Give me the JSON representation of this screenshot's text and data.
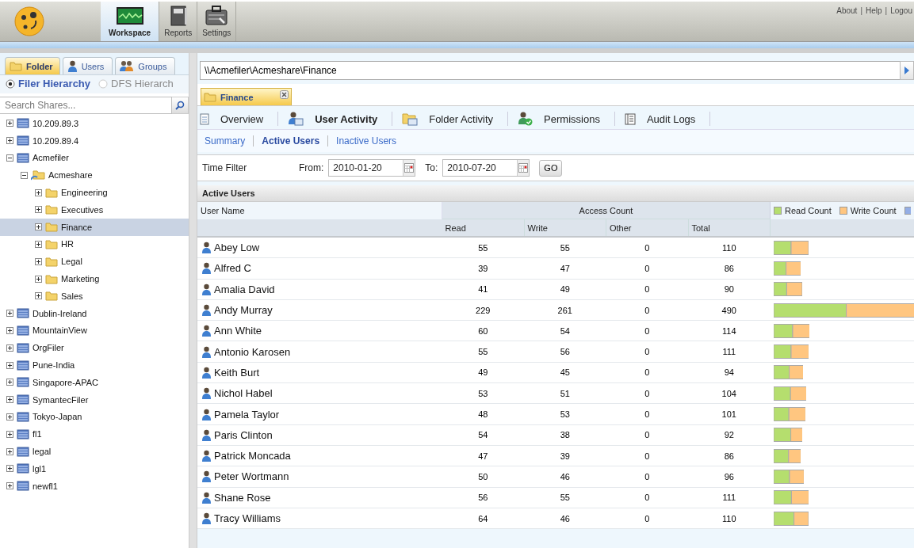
{
  "header": {
    "nav": [
      {
        "label": "Workspace",
        "kind": "monitor",
        "selected": true
      },
      {
        "label": "Reports",
        "kind": "book",
        "selected": false
      },
      {
        "label": "Settings",
        "kind": "toolbox",
        "selected": false
      }
    ],
    "links": [
      "About",
      "Help",
      "Logou"
    ],
    "link_separator": "|"
  },
  "sidebar": {
    "tabs": [
      {
        "label": "Folder",
        "kind": "folder",
        "selected": true
      },
      {
        "label": "Users",
        "kind": "user",
        "selected": false
      },
      {
        "label": "Groups",
        "kind": "group",
        "selected": false
      }
    ],
    "hierarchy": [
      {
        "label": "Filer Hierarchy",
        "selected": true,
        "disabled": false
      },
      {
        "label": "DFS Hierarch",
        "selected": false,
        "disabled": true
      }
    ],
    "search": {
      "placeholder": "Search Shares..."
    },
    "tree": [
      {
        "label": "10.209.89.3",
        "kind": "filer",
        "expanded": false,
        "selected": false
      },
      {
        "label": "10.209.89.4",
        "kind": "filer",
        "expanded": false,
        "selected": false
      },
      {
        "label": "Acmefiler",
        "kind": "filer",
        "expanded": true,
        "selected": false,
        "children": [
          {
            "label": "Acmeshare",
            "kind": "share",
            "expanded": true,
            "selected": false,
            "children": [
              {
                "label": "Engineering",
                "kind": "folder",
                "expanded": false,
                "selected": false
              },
              {
                "label": "Executives",
                "kind": "folder",
                "expanded": false,
                "selected": false
              },
              {
                "label": "Finance",
                "kind": "folder",
                "expanded": false,
                "selected": true
              },
              {
                "label": "HR",
                "kind": "folder",
                "expanded": false,
                "selected": false
              },
              {
                "label": "Legal",
                "kind": "folder",
                "expanded": false,
                "selected": false
              },
              {
                "label": "Marketing",
                "kind": "folder",
                "expanded": false,
                "selected": false
              },
              {
                "label": "Sales",
                "kind": "folder",
                "expanded": false,
                "selected": false
              }
            ]
          }
        ]
      },
      {
        "label": "Dublin-Ireland",
        "kind": "filer",
        "expanded": false,
        "selected": false
      },
      {
        "label": "MountainView",
        "kind": "filer",
        "expanded": false,
        "selected": false
      },
      {
        "label": "OrgFiler",
        "kind": "filer",
        "expanded": false,
        "selected": false
      },
      {
        "label": "Pune-India",
        "kind": "filer",
        "expanded": false,
        "selected": false
      },
      {
        "label": "Singapore-APAC",
        "kind": "filer",
        "expanded": false,
        "selected": false
      },
      {
        "label": "SymantecFiler",
        "kind": "filer",
        "expanded": false,
        "selected": false
      },
      {
        "label": "Tokyo-Japan",
        "kind": "filer",
        "expanded": false,
        "selected": false
      },
      {
        "label": "fl1",
        "kind": "filer",
        "expanded": false,
        "selected": false
      },
      {
        "label": "legal",
        "kind": "filer",
        "expanded": false,
        "selected": false
      },
      {
        "label": "lgl1",
        "kind": "filer",
        "expanded": false,
        "selected": false
      },
      {
        "label": "newfl1",
        "kind": "filer",
        "expanded": false,
        "selected": false
      }
    ]
  },
  "main": {
    "path": "\\\\Acmefiler\\Acmeshare\\Finance",
    "doc_tabs": [
      {
        "label": "Finance",
        "selected": true
      }
    ],
    "views": [
      {
        "label": "Overview",
        "kind": "document",
        "selected": false
      },
      {
        "label": "User Activity",
        "kind": "user-card",
        "selected": true
      },
      {
        "label": "Folder Activity",
        "kind": "folder-card",
        "selected": false
      },
      {
        "label": "Permissions",
        "kind": "user-check",
        "selected": false
      },
      {
        "label": "Audit Logs",
        "kind": "list",
        "selected": false
      }
    ],
    "sub_views": [
      {
        "label": "Summary",
        "selected": false
      },
      {
        "label": "Active Users",
        "selected": true
      },
      {
        "label": "Inactive Users",
        "selected": false
      }
    ],
    "time_filter": {
      "label": "Time Filter",
      "from_label": "From:",
      "from_value": "2010-01-20",
      "to_label": "To:",
      "to_value": "2010-07-20",
      "go": "GO"
    },
    "table": {
      "title": "Active Users",
      "user_column": "User Name",
      "group_column": "Access Count",
      "columns": [
        "Read",
        "Write",
        "Other",
        "Total"
      ],
      "legend": [
        {
          "label": "Read Count",
          "color": "#b5de6e"
        },
        {
          "label": "Write Count",
          "color": "#ffc680"
        },
        {
          "color": "#93aee6"
        }
      ],
      "rows": [
        {
          "name": "Abey Low",
          "read": "55",
          "write": "55",
          "other": "0",
          "total": "110"
        },
        {
          "name": "Alfred C",
          "read": "39",
          "write": "47",
          "other": "0",
          "total": "86"
        },
        {
          "name": "Amalia David",
          "read": "41",
          "write": "49",
          "other": "0",
          "total": "90"
        },
        {
          "name": "Andy Murray",
          "read": "229",
          "write": "261",
          "other": "0",
          "total": "490"
        },
        {
          "name": "Ann White",
          "read": "60",
          "write": "54",
          "other": "0",
          "total": "114"
        },
        {
          "name": "Antonio Karosen",
          "read": "55",
          "write": "56",
          "other": "0",
          "total": "111"
        },
        {
          "name": "Keith Burt",
          "read": "49",
          "write": "45",
          "other": "0",
          "total": "94"
        },
        {
          "name": "Nichol Habel",
          "read": "53",
          "write": "51",
          "other": "0",
          "total": "104"
        },
        {
          "name": "Pamela Taylor",
          "read": "48",
          "write": "53",
          "other": "0",
          "total": "101"
        },
        {
          "name": "Paris Clinton",
          "read": "54",
          "write": "38",
          "other": "0",
          "total": "92"
        },
        {
          "name": "Patrick Moncada",
          "read": "47",
          "write": "39",
          "other": "0",
          "total": "86"
        },
        {
          "name": "Peter Wortmann",
          "read": "50",
          "write": "46",
          "other": "0",
          "total": "96"
        },
        {
          "name": "Shane Rose",
          "read": "56",
          "write": "55",
          "other": "0",
          "total": "111"
        },
        {
          "name": "Tracy Williams",
          "read": "64",
          "write": "46",
          "other": "0",
          "total": "110"
        }
      ]
    }
  }
}
